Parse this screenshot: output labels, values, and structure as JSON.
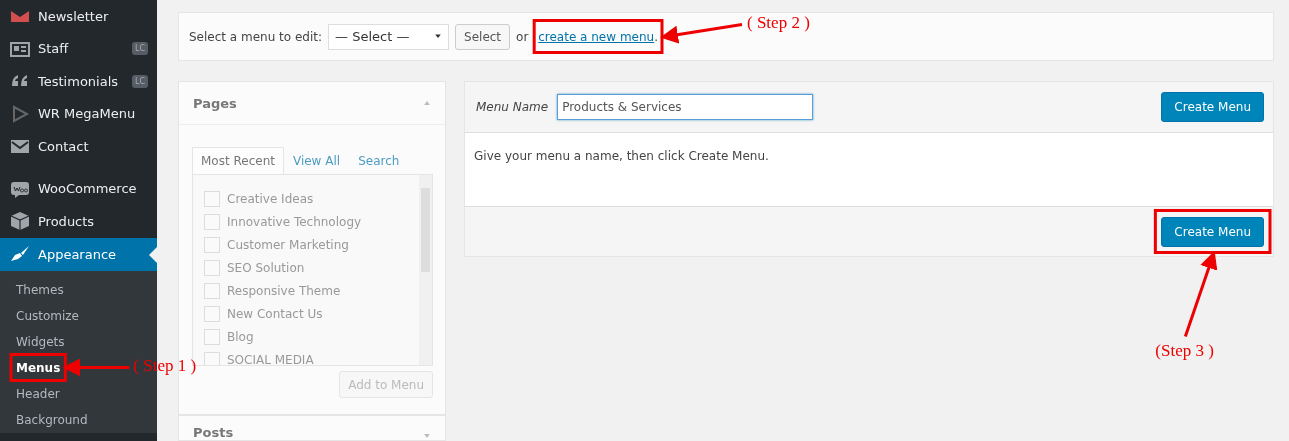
{
  "sidebar": {
    "items": [
      {
        "label": "Newsletter",
        "selected": false
      },
      {
        "label": "Staff",
        "badge": "LC",
        "selected": false
      },
      {
        "label": "Testimonials",
        "badge": "LC",
        "selected": false
      },
      {
        "label": "WR MegaMenu",
        "selected": false
      },
      {
        "label": "Contact",
        "selected": false
      },
      {
        "label": "WooCommerce",
        "selected": false
      },
      {
        "label": "Products",
        "selected": false
      },
      {
        "label": "Appearance",
        "selected": true
      }
    ],
    "submenu": [
      {
        "label": "Themes",
        "selected": false
      },
      {
        "label": "Customize",
        "selected": false
      },
      {
        "label": "Widgets",
        "selected": false
      },
      {
        "label": "Menus",
        "selected": true
      },
      {
        "label": "Header",
        "selected": false
      },
      {
        "label": "Background",
        "selected": false
      }
    ]
  },
  "menu_select_bar": {
    "label": "Select a menu to edit:",
    "dropdown": "— Select —",
    "button": "Select",
    "or_text": "or",
    "link": "create a new menu",
    "link_suffix": "."
  },
  "pages_box": {
    "title": "Pages",
    "tabs": [
      {
        "label": "Most Recent",
        "selected": true
      },
      {
        "label": "View All",
        "selected": false
      },
      {
        "label": "Search",
        "selected": false
      }
    ],
    "items": [
      {
        "label": "Creative Ideas",
        "checked": false
      },
      {
        "label": "Innovative Technology",
        "checked": false
      },
      {
        "label": "Customer Marketing",
        "checked": false
      },
      {
        "label": "SEO Solution",
        "checked": false
      },
      {
        "label": "Responsive Theme",
        "checked": false
      },
      {
        "label": "New Contact Us",
        "checked": false
      },
      {
        "label": "Blog",
        "checked": false
      },
      {
        "label": "SOCIAL MEDIA",
        "checked": false
      }
    ],
    "button": "Add to Menu",
    "button_disabled": true
  },
  "posts_box": {
    "title": "Posts"
  },
  "menu_editor": {
    "name_label": "Menu Name",
    "name_value": "Products & Services",
    "top_button": "Create Menu",
    "hint": "Give your menu a name, then click Create Menu.",
    "bottom_button": "Create Menu"
  },
  "annotations": [
    {
      "label": "( Step 1 )"
    },
    {
      "label": "( Step 2 )"
    },
    {
      "label": "(Step 3 )"
    }
  ]
}
